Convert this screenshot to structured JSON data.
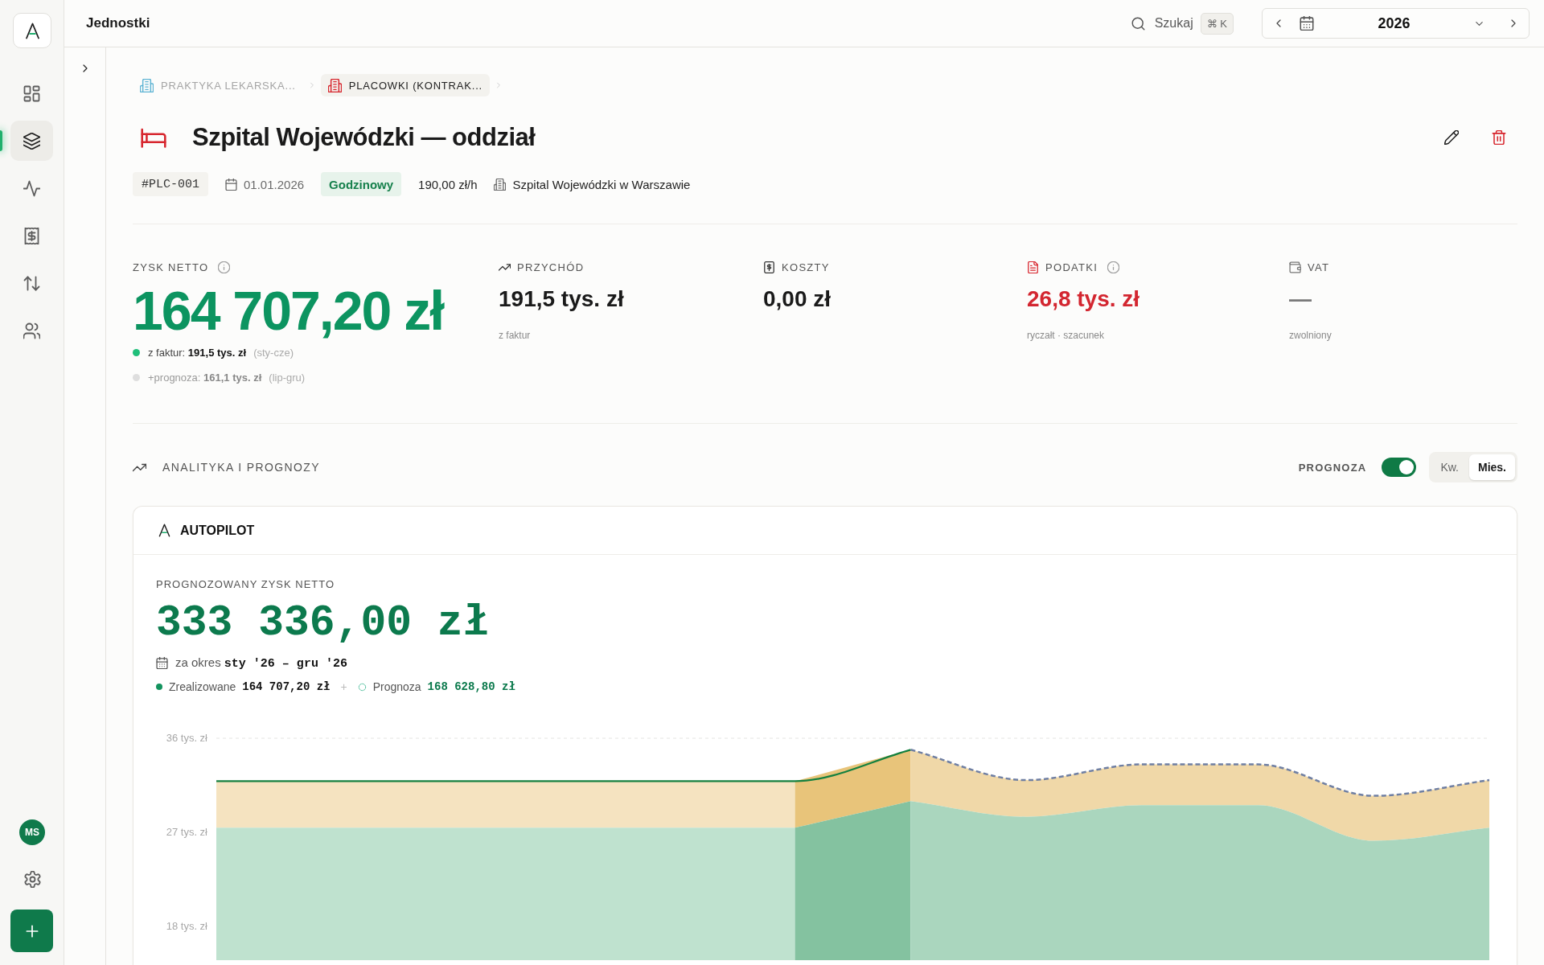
{
  "sidebar": {
    "items": [
      {
        "kind": "grid",
        "selected": false
      },
      {
        "kind": "layers",
        "selected": true
      },
      {
        "kind": "pulse",
        "selected": false
      },
      {
        "kind": "receipt",
        "selected": false
      },
      {
        "kind": "arrows",
        "selected": false
      },
      {
        "kind": "users",
        "selected": false
      }
    ],
    "user": {
      "initials": "MS"
    }
  },
  "top_bar": {
    "title": "Jednostki",
    "search": {
      "label": "Szukaj",
      "shortcut": "⌘ K"
    },
    "year_picker": {
      "value": "2026"
    }
  },
  "breadcrumb": [
    {
      "label": "PRAKTYKA LEKARSKA...",
      "selected": false,
      "color": "#5fb4d4"
    },
    {
      "label": "PLACOWKI (KONTRAK...",
      "selected": true,
      "color": "#d7262e"
    }
  ],
  "unit": {
    "title": "Szpital Wojewódzki — oddział",
    "code": "#PLC-001",
    "date": "01.01.2026",
    "billing": "Godzinowy",
    "rate": "190,00 zł/h",
    "location": "Szpital Wojewódzki w Warszawie"
  },
  "net_profit": {
    "label": "ZYSK NETTO",
    "info": true,
    "value": "164 707,20 zł",
    "lines": [
      {
        "kind": "realized",
        "text": "z faktur: **191,5 tys. zł**",
        "period": "(sty-cze)"
      },
      {
        "kind": "forecast",
        "text": "+prognoza: **161,1 tys. zł**",
        "period": "(lip-gru)"
      }
    ]
  },
  "metrics": [
    {
      "kind": "revenue",
      "label": "PRZYCHÓD",
      "info": false,
      "value": "191,5 tys. zł",
      "note": "z faktur"
    },
    {
      "kind": "costs",
      "label": "KOSZTY",
      "info": false,
      "value": "0,00 zł"
    },
    {
      "kind": "taxes",
      "label": "PODATKI",
      "info": true,
      "value": "26,8 tys. zł",
      "note": "ryczałt · szacunek"
    },
    {
      "kind": "vat",
      "label": "VAT",
      "info": false,
      "value": "—",
      "note": "zwolniony"
    }
  ],
  "analytics": {
    "title": "ANALITYKA I PROGNOZY",
    "forecast_toggle": {
      "label": "PROGNOZA",
      "on": true
    },
    "granularity": [
      {
        "label": "Kw.",
        "selected": false
      },
      {
        "label": "Mies.",
        "selected": true
      }
    ]
  },
  "autopilot": {
    "title": "AUTOPILOT",
    "metric_label": "PROGNOZOWANY ZYSK NETTO",
    "value": "333 336,00 zł",
    "period": "za okres **sty '26 – gru '26**",
    "legend": [
      {
        "kind": "realized",
        "label": "Zrealizowane",
        "amount": "164 707,20 zł"
      },
      {
        "kind": "forecast",
        "label": "Prognoza",
        "amount": "168 628,80 zł"
      }
    ],
    "legend_separator": "+",
    "chart_data": {
      "type": "area",
      "categories": [
        null,
        null,
        null,
        null,
        null,
        null,
        null,
        null,
        null,
        null,
        null,
        null
      ],
      "ylim": [
        18,
        36
      ],
      "yticks": [
        {
          "value": 36,
          "label": "36 tys. zł"
        },
        {
          "value": 27,
          "label": "27 tys. zł"
        },
        {
          "value": 18,
          "label": "18 tys. zł"
        }
      ],
      "series": [
        {
          "type": "area",
          "color": "#f5e3c0",
          "values": [
            31.9,
            31.9,
            31.9,
            31.9,
            31.9,
            31.9,
            null,
            null,
            null,
            null,
            null,
            null
          ]
        },
        {
          "type": "area",
          "color": "#e8c47a",
          "values": [
            null,
            null,
            null,
            null,
            null,
            31.9,
            34.9,
            null,
            null,
            null,
            null,
            null
          ]
        },
        {
          "type": "area",
          "color": "#f0d8a8",
          "values": [
            null,
            null,
            null,
            null,
            null,
            null,
            34.9,
            32.0,
            33.5,
            33.5,
            30.5,
            32.0
          ]
        },
        {
          "type": "area",
          "color": "#bfe2cf",
          "values": [
            27.45,
            27.45,
            27.45,
            27.45,
            27.45,
            27.45,
            null,
            null,
            null,
            null,
            null,
            null
          ]
        },
        {
          "type": "area",
          "color": "#84c2a0",
          "values": [
            null,
            null,
            null,
            null,
            null,
            27.45,
            30.0,
            null,
            null,
            null,
            null,
            null
          ]
        },
        {
          "type": "area",
          "color": "#aad6be",
          "values": [
            null,
            null,
            null,
            null,
            null,
            null,
            30.0,
            28.5,
            29.6,
            29.6,
            26.2,
            27.45
          ]
        },
        {
          "type": "line",
          "color": "#13803f",
          "values": [
            31.9,
            31.9,
            31.9,
            31.9,
            31.9,
            31.9,
            34.9,
            null,
            null,
            null,
            null,
            null
          ]
        },
        {
          "type": "line",
          "color": "#6f7fa3",
          "line_style": "dashed",
          "values": [
            null,
            null,
            null,
            null,
            null,
            null,
            34.9,
            32.0,
            33.5,
            33.5,
            30.5,
            32.0
          ]
        }
      ]
    }
  }
}
